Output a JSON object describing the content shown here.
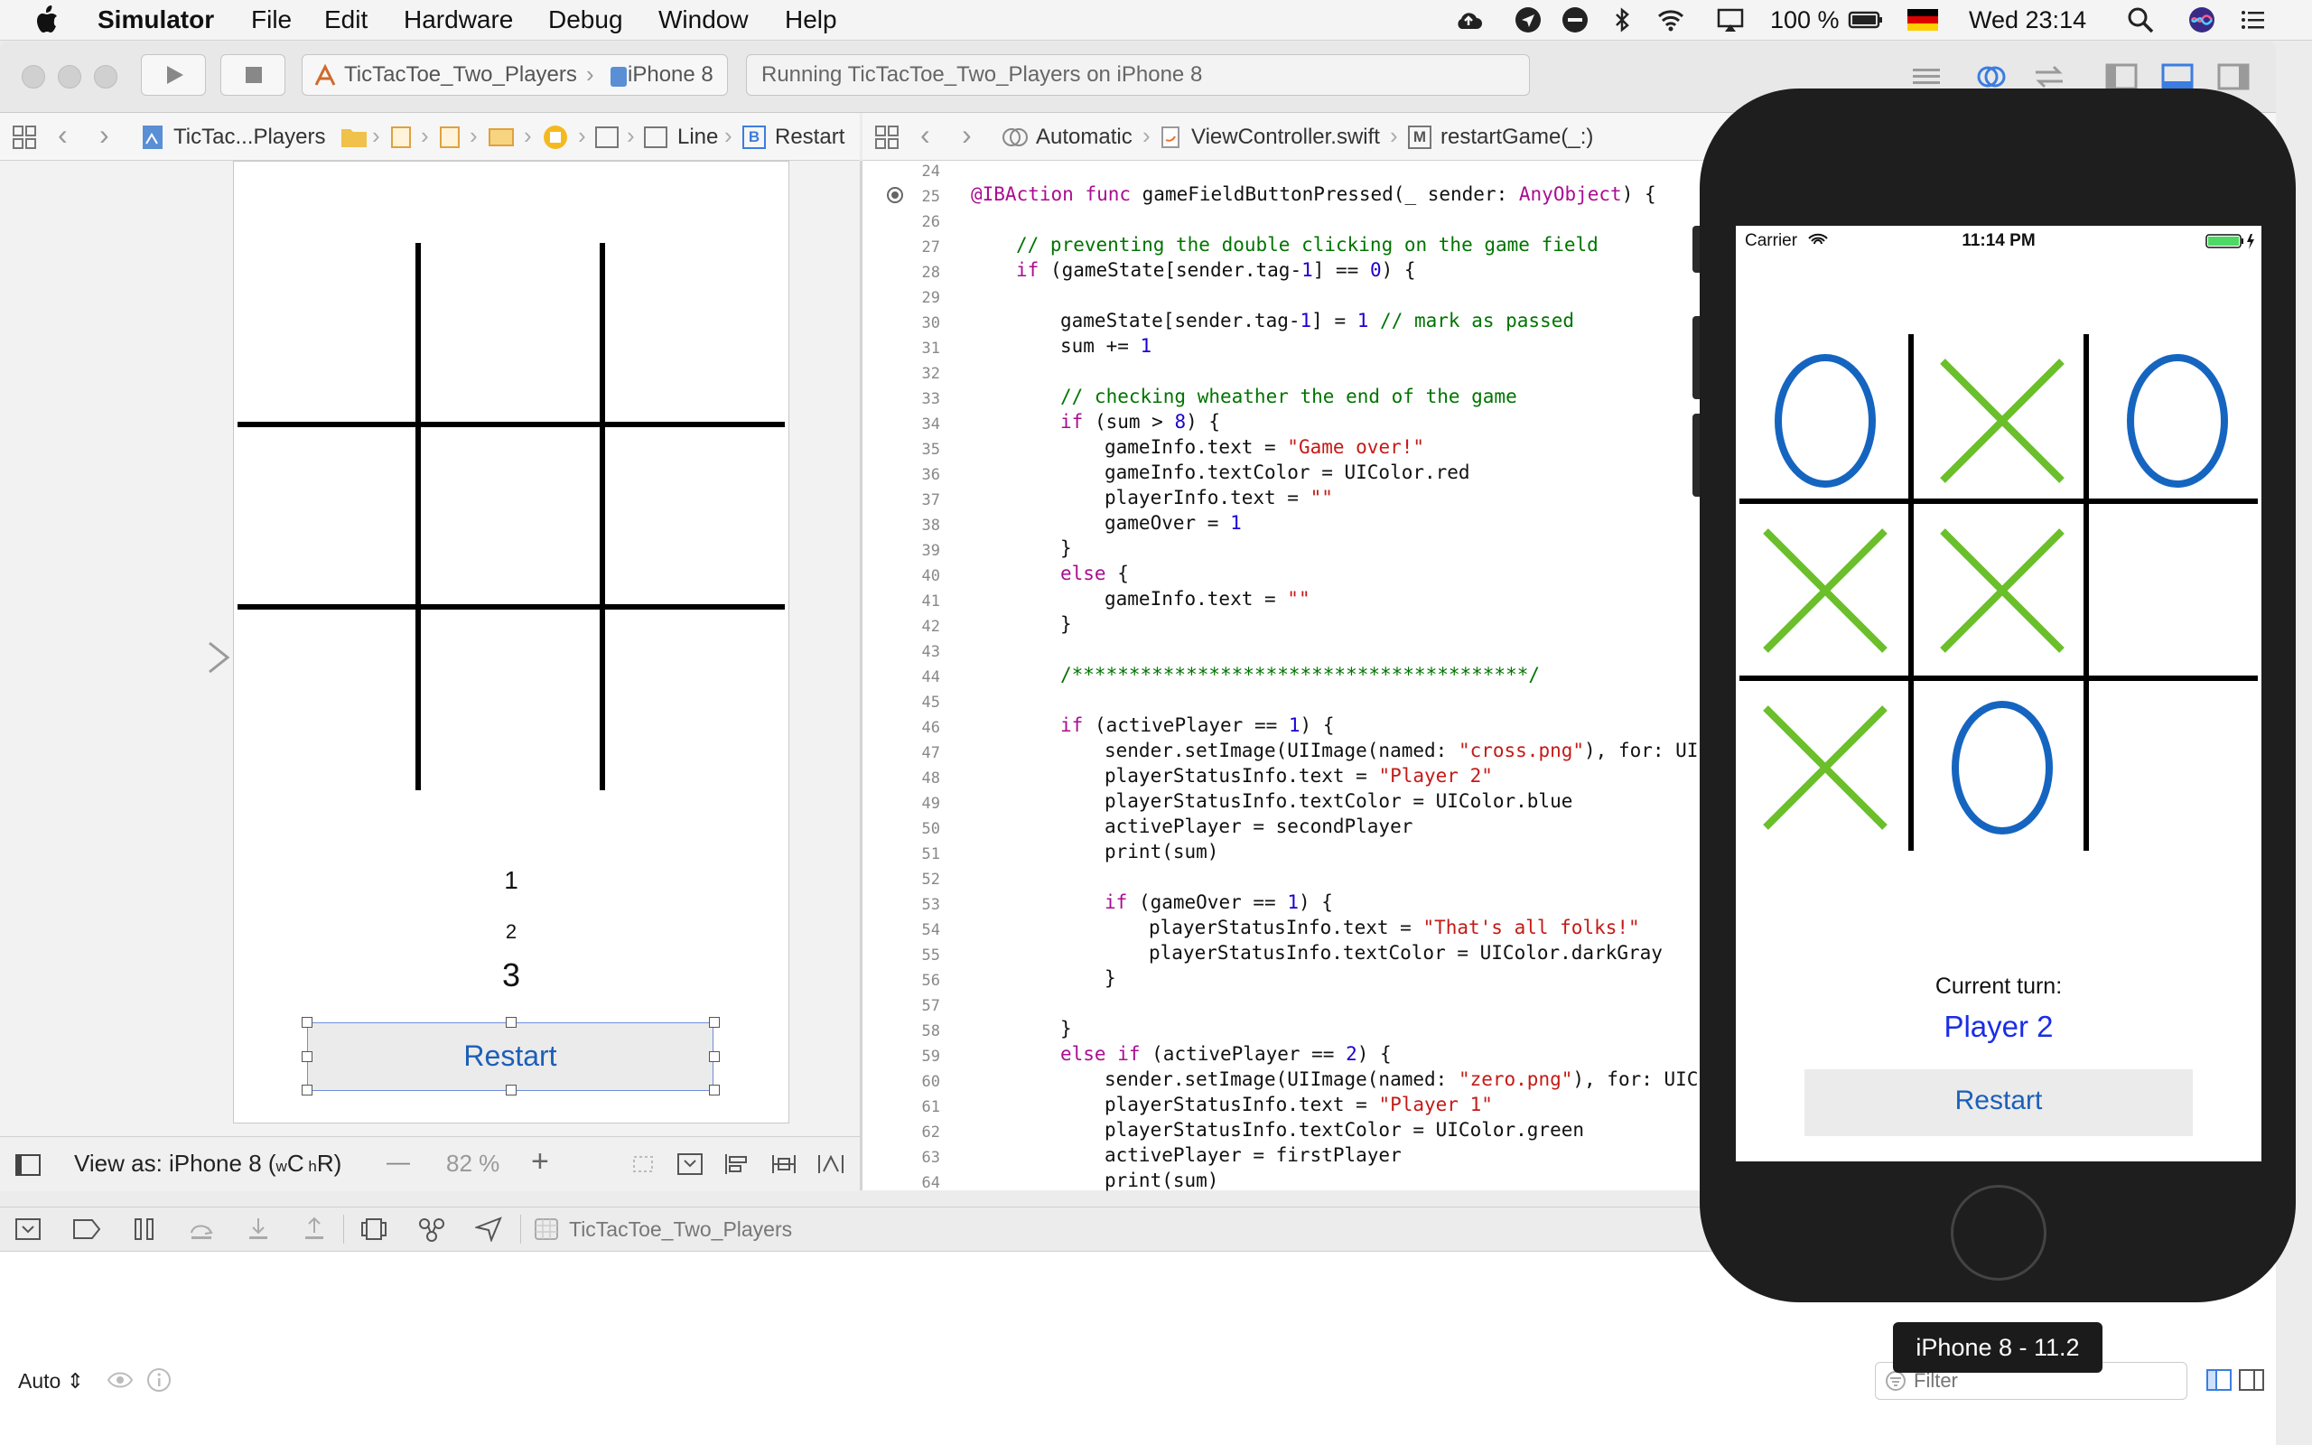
{
  "menubar": {
    "app": "Simulator",
    "items": [
      "File",
      "Edit",
      "Hardware",
      "Debug",
      "Window",
      "Help"
    ],
    "battery": "100 %",
    "clock": "Wed 23:14"
  },
  "toolbar": {
    "scheme": "TicTacToe_Two_Players",
    "device": "iPhone 8",
    "activity": "Running TicTacToe_Two_Players on iPhone 8"
  },
  "left_jumpbar": {
    "project": "TicTac...Players",
    "line": "Line",
    "restart": "Restart",
    "restart_badge": "B"
  },
  "right_jumpbar": {
    "mode": "Automatic",
    "file": "ViewController.swift",
    "method_badge": "M",
    "method": "restartGame(_:)"
  },
  "storyboard": {
    "label1": "1",
    "label2": "2",
    "label3": "3",
    "restart_button": "Restart",
    "view_as": "View as: iPhone 8 (",
    "size_class_w": "w",
    "size_class_c": "C",
    "size_class_h": "h",
    "size_class_r": "R)",
    "zoom_minus": "—",
    "zoom": "82 %",
    "zoom_plus": "+"
  },
  "code": {
    "lines": [
      {
        "n": "24",
        "t": ""
      },
      {
        "n": "25",
        "t": ""
      },
      {
        "n": "26",
        "t": ""
      },
      {
        "n": "27",
        "t": ""
      },
      {
        "n": "28",
        "t": ""
      },
      {
        "n": "29",
        "t": ""
      },
      {
        "n": "30",
        "t": ""
      },
      {
        "n": "31",
        "t": ""
      },
      {
        "n": "32",
        "t": ""
      },
      {
        "n": "33",
        "t": ""
      },
      {
        "n": "34",
        "t": ""
      },
      {
        "n": "35",
        "t": ""
      },
      {
        "n": "36",
        "t": ""
      },
      {
        "n": "37",
        "t": ""
      },
      {
        "n": "38",
        "t": ""
      },
      {
        "n": "39",
        "t": ""
      },
      {
        "n": "40",
        "t": ""
      },
      {
        "n": "41",
        "t": ""
      },
      {
        "n": "42",
        "t": ""
      },
      {
        "n": "43",
        "t": ""
      },
      {
        "n": "44",
        "t": ""
      },
      {
        "n": "45",
        "t": ""
      },
      {
        "n": "46",
        "t": ""
      },
      {
        "n": "47",
        "t": ""
      },
      {
        "n": "48",
        "t": ""
      },
      {
        "n": "49",
        "t": ""
      },
      {
        "n": "50",
        "t": ""
      },
      {
        "n": "51",
        "t": ""
      },
      {
        "n": "52",
        "t": ""
      },
      {
        "n": "53",
        "t": ""
      },
      {
        "n": "54",
        "t": ""
      },
      {
        "n": "55",
        "t": ""
      },
      {
        "n": "56",
        "t": ""
      },
      {
        "n": "57",
        "t": ""
      },
      {
        "n": "58",
        "t": ""
      },
      {
        "n": "59",
        "t": ""
      },
      {
        "n": "60",
        "t": ""
      },
      {
        "n": "61",
        "t": ""
      },
      {
        "n": "62",
        "t": ""
      },
      {
        "n": "63",
        "t": ""
      },
      {
        "n": "64",
        "t": ""
      }
    ],
    "l25a": "@IBAction",
    "l25b": " func ",
    "l25c": "gameFieldButtonPressed(_ sender: ",
    "l25d": "AnyObject",
    "l25e": ") {",
    "l27": "// preventing the double clicking on the game field",
    "l28a": "if",
    "l28b": " (gameState[sender.tag-",
    "l28c": "1",
    "l28d": "] == ",
    "l28e": "0",
    "l28f": ") {",
    "l30a": "gameState[sender.tag-",
    "l30b": "1",
    "l30c": "] = ",
    "l30d": "1",
    "l30e": " // mark as passed",
    "l31a": "sum += ",
    "l31b": "1",
    "l33": "// checking wheather the end of the game",
    "l34a": "if",
    "l34b": " (sum > ",
    "l34c": "8",
    "l34d": ") {",
    "l35a": "gameInfo.text = ",
    "l35b": "\"Game over!\"",
    "l36": "gameInfo.textColor = UIColor.red",
    "l37a": "playerInfo.text = ",
    "l37b": "\"\"",
    "l38a": "gameOver = ",
    "l38b": "1",
    "l39": "}",
    "l40a": "else",
    "l40b": " {",
    "l41a": "gameInfo.text = ",
    "l41b": "\"\"",
    "l42": "}",
    "l44": "/****************************************/",
    "l46a": "if",
    "l46b": " (activePlayer == ",
    "l46c": "1",
    "l46d": ") {",
    "l47a": "sender.setImage(UIImage(named: ",
    "l47b": "\"cross.png\"",
    "l47c": "), for: UICo",
    "l48a": "playerStatusInfo.text = ",
    "l48b": "\"Player 2\"",
    "l49": "playerStatusInfo.textColor = UIColor.blue",
    "l50": "activePlayer = secondPlayer",
    "l51": "print(sum)",
    "l53a": "if",
    "l53b": " (gameOver == ",
    "l53c": "1",
    "l53d": ") {",
    "l54a": "playerStatusInfo.text = ",
    "l54b": "\"That's all folks!\"",
    "l55": "playerStatusInfo.textColor = UIColor.darkGray",
    "l56": "}",
    "l58": "}",
    "l59a": "else if",
    "l59b": " (activePlayer == ",
    "l59c": "2",
    "l59d": ") {",
    "l60a": "sender.setImage(UIImage(named: ",
    "l60b": "\"zero.png\"",
    "l60c": "), for: UICon",
    "l61a": "playerStatusInfo.text = ",
    "l61b": "\"Player 1\"",
    "l62": "playerStatusInfo.textColor = UIColor.green",
    "l63": "activePlayer = firstPlayer",
    "l64": "print(sum)"
  },
  "debugbar": {
    "target": "TicTacToe_Two_Players"
  },
  "console": {
    "auto": "Auto",
    "filter_placeholder": "Filter"
  },
  "simulator": {
    "carrier": "Carrier",
    "time": "11:14 PM",
    "board": [
      "O",
      "X",
      "O",
      "X",
      "X",
      "",
      "X",
      "O",
      ""
    ],
    "current_turn_label": "Current turn:",
    "current_player": "Player 2",
    "restart_button": "Restart",
    "device_label": "iPhone 8 - 11.2",
    "o_color": "#1565c0",
    "x_color": "#6abf2a",
    "player_color": "#1a2de6"
  }
}
